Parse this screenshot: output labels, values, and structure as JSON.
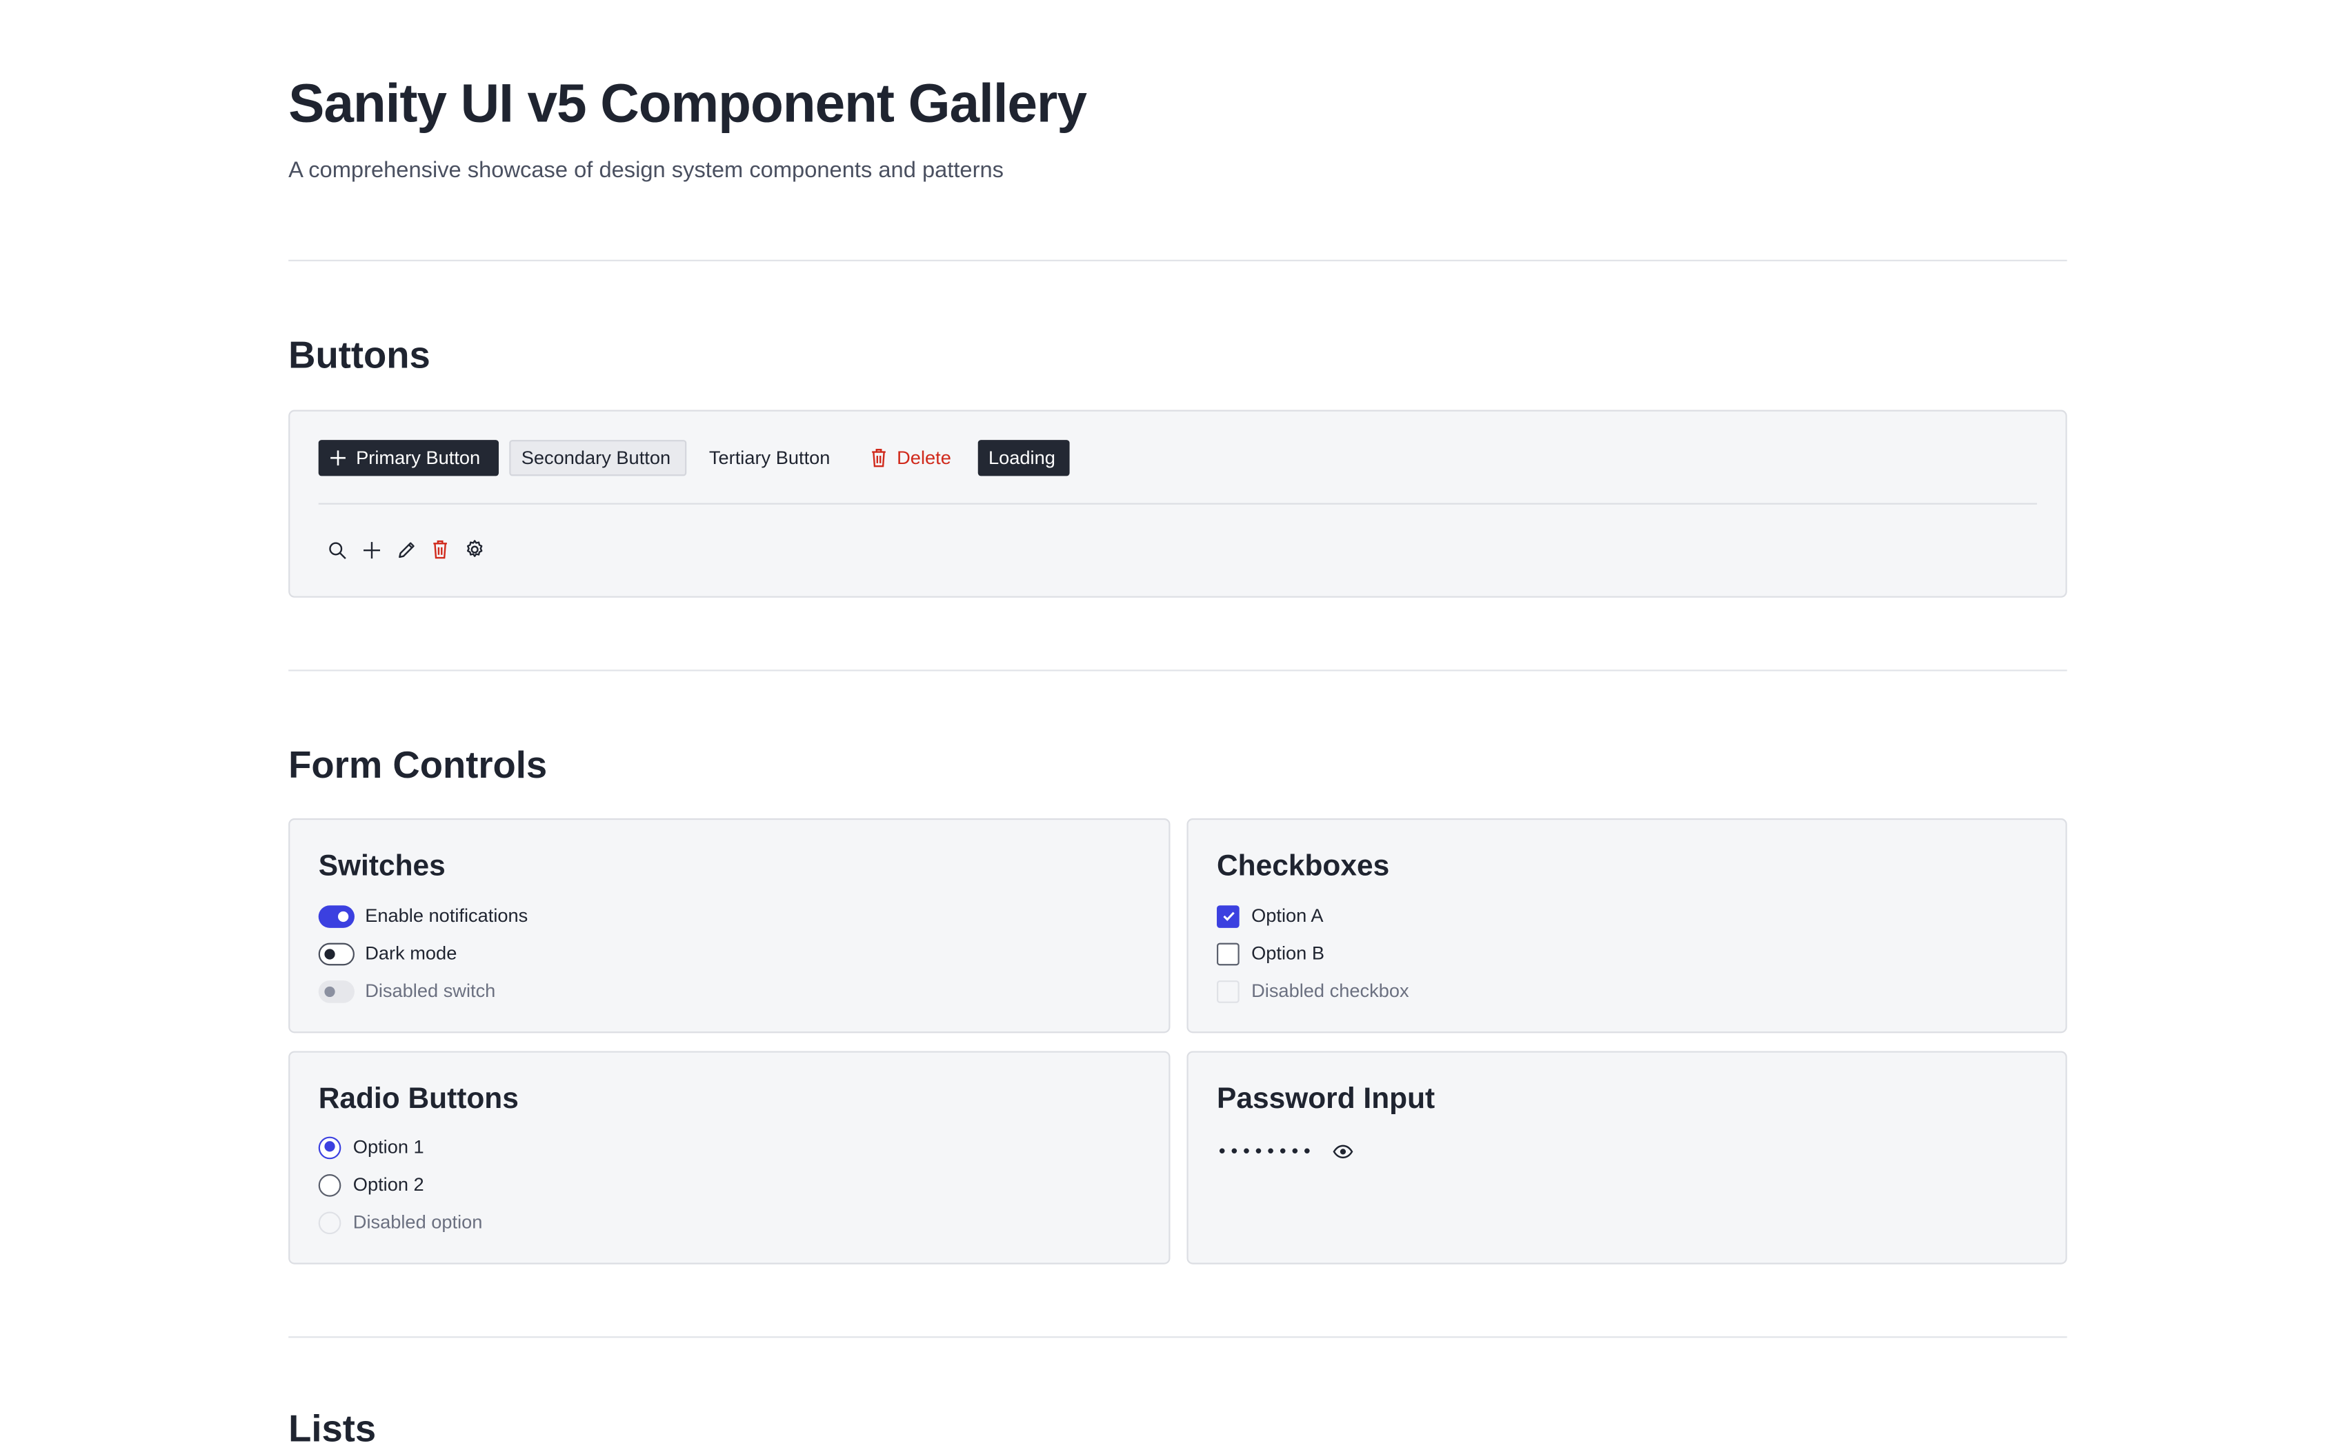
{
  "header": {
    "title": "Sanity UI v5 Component Gallery",
    "subtitle": "A comprehensive showcase of design system components and patterns"
  },
  "buttons_section": {
    "heading": "Buttons",
    "buttons": {
      "primary": {
        "label": "Primary Button",
        "icon": "plus-icon"
      },
      "secondary": {
        "label": "Secondary Button"
      },
      "tertiary": {
        "label": "Tertiary Button"
      },
      "danger": {
        "label": "Delete",
        "icon": "trash-icon"
      },
      "loading": {
        "label": "Loading"
      }
    },
    "icon_buttons": [
      "search-icon",
      "plus-icon",
      "edit-icon",
      "trash-icon",
      "gear-icon"
    ]
  },
  "form_section": {
    "heading": "Form Controls",
    "switches": {
      "title": "Switches",
      "items": [
        {
          "label": "Enable notifications",
          "state": "on"
        },
        {
          "label": "Dark mode",
          "state": "off"
        },
        {
          "label": "Disabled switch",
          "state": "disabled"
        }
      ]
    },
    "checkboxes": {
      "title": "Checkboxes",
      "items": [
        {
          "label": "Option A",
          "state": "checked"
        },
        {
          "label": "Option B",
          "state": "unchecked"
        },
        {
          "label": "Disabled checkbox",
          "state": "disabled"
        }
      ]
    },
    "radios": {
      "title": "Radio Buttons",
      "items": [
        {
          "label": "Option 1",
          "state": "selected"
        },
        {
          "label": "Option 2",
          "state": "unselected"
        },
        {
          "label": "Disabled option",
          "state": "disabled"
        }
      ]
    },
    "password": {
      "title": "Password Input",
      "masked_value": "••••••••",
      "toggle_icon": "eye-icon"
    }
  },
  "lists_section": {
    "heading": "Lists"
  },
  "colors": {
    "accent": "#3b40e0",
    "primary_button": "#232833",
    "danger": "#d0291b",
    "card_bg": "#f5f6f8"
  }
}
